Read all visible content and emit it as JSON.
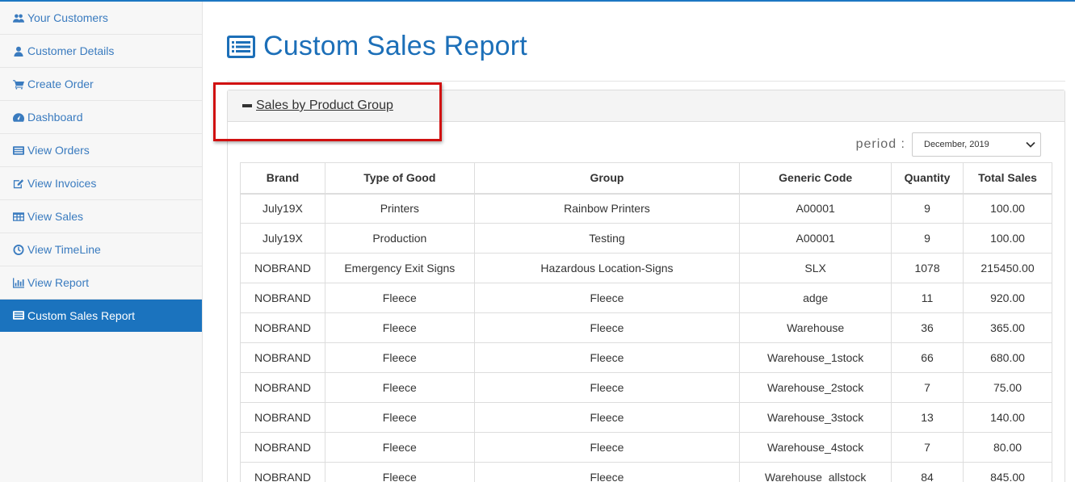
{
  "sidebar": {
    "items": [
      {
        "label": "Your Customers",
        "icon": "users-icon"
      },
      {
        "label": "Customer Details",
        "icon": "user-icon"
      },
      {
        "label": "Create Order",
        "icon": "cart-icon"
      },
      {
        "label": "Dashboard",
        "icon": "dashboard-icon"
      },
      {
        "label": "View Orders",
        "icon": "list-icon"
      },
      {
        "label": "View Invoices",
        "icon": "edit-icon"
      },
      {
        "label": "View Sales",
        "icon": "table-icon"
      },
      {
        "label": "View TimeLine",
        "icon": "clock-icon"
      },
      {
        "label": "View Report",
        "icon": "bar-chart-icon"
      },
      {
        "label": "Custom Sales Report",
        "icon": "list-alt-icon",
        "active": true
      }
    ]
  },
  "page": {
    "title": "Custom Sales Report",
    "icon": "list-alt-icon"
  },
  "panel": {
    "toggle_label": " Sales by Product Group",
    "icon": "minus-icon"
  },
  "period": {
    "label": "period :",
    "selected": "December, 2019"
  },
  "table": {
    "headers": [
      "Brand",
      "Type of Good",
      "Group",
      "Generic Code",
      "Quantity",
      "Total Sales"
    ],
    "rows": [
      [
        "July19X",
        "Printers",
        "Rainbow Printers",
        "A00001",
        "9",
        "100.00"
      ],
      [
        "July19X",
        "Production",
        "Testing",
        "A00001",
        "9",
        "100.00"
      ],
      [
        "NOBRAND",
        "Emergency Exit Signs",
        "Hazardous Location-Signs",
        "SLX",
        "1078",
        "215450.00"
      ],
      [
        "NOBRAND",
        "Fleece",
        "Fleece",
        "adge",
        "11",
        "920.00"
      ],
      [
        "NOBRAND",
        "Fleece",
        "Fleece",
        "Warehouse",
        "36",
        "365.00"
      ],
      [
        "NOBRAND",
        "Fleece",
        "Fleece",
        "Warehouse_1stock",
        "66",
        "680.00"
      ],
      [
        "NOBRAND",
        "Fleece",
        "Fleece",
        "Warehouse_2stock",
        "7",
        "75.00"
      ],
      [
        "NOBRAND",
        "Fleece",
        "Fleece",
        "Warehouse_3stock",
        "13",
        "140.00"
      ],
      [
        "NOBRAND",
        "Fleece",
        "Fleece",
        "Warehouse_4stock",
        "7",
        "80.00"
      ],
      [
        "NOBRAND",
        "Fleece",
        "Fleece",
        "Warehouse_allstock",
        "84",
        "845.00"
      ]
    ]
  },
  "colors": {
    "accent": "#1b73be",
    "title": "#1c6fb8",
    "link": "#3a7bbf",
    "highlight_box": "#d01010"
  }
}
